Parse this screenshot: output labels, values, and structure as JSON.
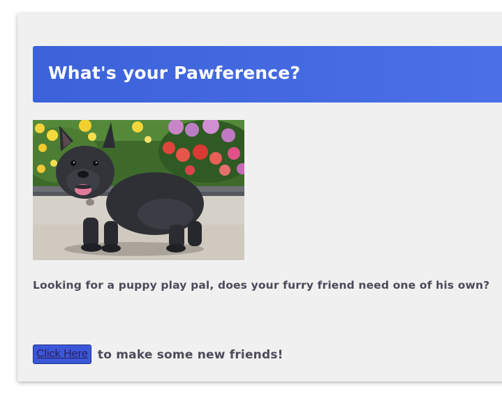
{
  "header": {
    "title": "What's your Pawference?"
  },
  "image": {
    "icon": "french-bulldog-puppy-photo"
  },
  "description": "Looking for a puppy play pal, does your furry friend need one of his own?",
  "cta": {
    "button_label": "Click Here",
    "trailing_text": "to make some new friends!"
  },
  "colors": {
    "header_bg": "#4065e0",
    "card_bg": "#f0f0f0",
    "button_bg": "#3b57d9",
    "text": "#4a4a5a"
  }
}
